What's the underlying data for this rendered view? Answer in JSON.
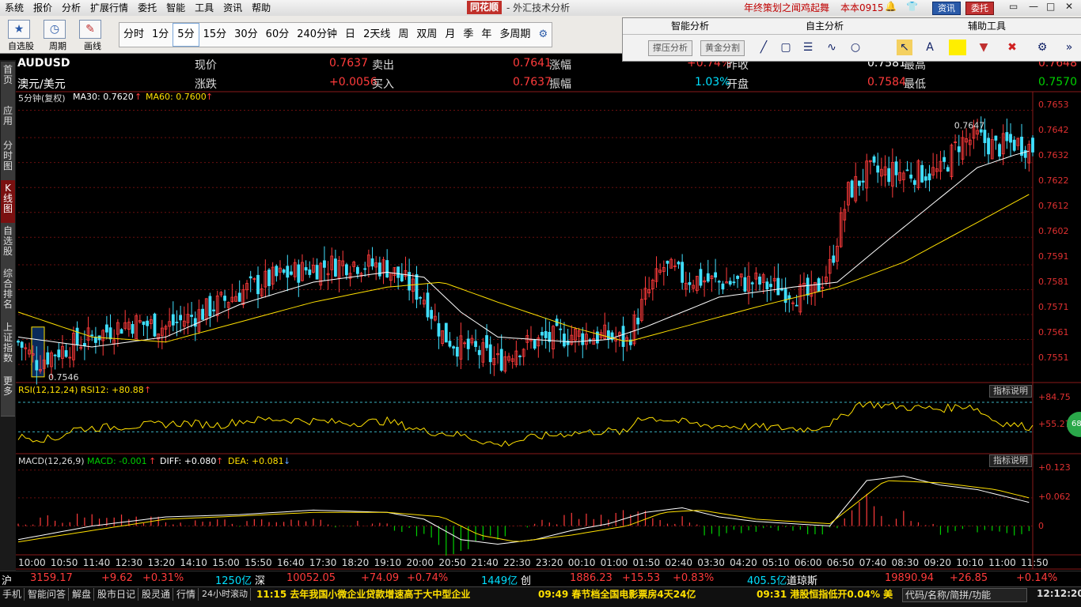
{
  "menu": [
    "系统",
    "报价",
    "分析",
    "扩展行情",
    "委托",
    "智能",
    "工具",
    "资讯",
    "帮助"
  ],
  "logo": "同花顺",
  "app_title": "- 外汇技术分析",
  "promo": "年终策划之闻鸡起舞",
  "version": "本本0915",
  "btn_news": "资讯",
  "btn_trade": "委托",
  "toolbar": {
    "select_label": "自选股",
    "period_label": "周期",
    "draw_label": "画线"
  },
  "periods": [
    "分时",
    "1分",
    "5分",
    "15分",
    "30分",
    "60分",
    "240分钟",
    "日",
    "2天线",
    "周",
    "双周",
    "月",
    "季",
    "年",
    "多周期"
  ],
  "periods_selected": "5分",
  "panel": {
    "smart": "智能分析",
    "custom": "自主分析",
    "aux": "辅助工具",
    "btn_support": "撑压分析",
    "btn_golden": "黄金分割"
  },
  "left_tabs": [
    "首页",
    "应用",
    "分时图",
    "K线图",
    "自选股",
    "综合排名",
    "上证指数",
    "更多"
  ],
  "left_tab_selected": "K线图",
  "quote": {
    "symbol": "AUDUSD",
    "name": "澳元/美元",
    "l_now": "现价",
    "v_now": "0.7637",
    "l_change": "涨跌",
    "v_change": "+0.0056",
    "l_sell": "卖出",
    "v_sell": "0.7641",
    "l_buy": "买入",
    "v_buy": "0.7637",
    "l_pct": "涨幅",
    "v_pct": "+0.74%",
    "l_amp": "振幅",
    "v_amp": "1.03%",
    "l_prev": "昨收",
    "v_prev": "0.7581",
    "l_open": "开盘",
    "v_open": "0.7584",
    "l_high": "最高",
    "v_high": "0.7648",
    "l_low": "最低",
    "v_low": "0.7570"
  },
  "main_info": {
    "period": "5分钟(复权)",
    "ma30": "MA30: 0.7620",
    "ma60": "MA60: 0.7600"
  },
  "rsi_info": "RSI(12,12,24)  RSI12: +80.88",
  "macd_info": {
    "name": "MACD(12,26,9)",
    "macd": "MACD: -0.001",
    "diff": "DIFF: +0.080",
    "dea": "DEA: +0.081"
  },
  "indicator_btn": "指标说明",
  "badge": "68",
  "chart_data": {
    "type": "candlestick",
    "series": [
      {
        "name": "MA30"
      },
      {
        "name": "MA60"
      }
    ],
    "y_ticks": [
      "0.7653",
      "0.7642",
      "0.7632",
      "0.7622",
      "0.7612",
      "0.7602",
      "0.7591",
      "0.7581",
      "0.7571",
      "0.7561",
      "0.7551"
    ],
    "ylim": [
      0.7545,
      0.7656
    ],
    "high_label": "0.7647",
    "low_label": "0.7546",
    "close_path": [
      [
        0,
        0.756
      ],
      [
        5,
        0.7552
      ],
      [
        10,
        0.7556
      ],
      [
        20,
        0.7562
      ],
      [
        30,
        0.7568
      ],
      [
        40,
        0.7566
      ],
      [
        50,
        0.7572
      ],
      [
        60,
        0.758
      ],
      [
        70,
        0.7586
      ],
      [
        80,
        0.759
      ],
      [
        90,
        0.7592
      ],
      [
        100,
        0.759
      ],
      [
        110,
        0.7578
      ],
      [
        115,
        0.7563
      ],
      [
        120,
        0.7558
      ],
      [
        125,
        0.7556
      ],
      [
        130,
        0.7552
      ],
      [
        135,
        0.7558
      ],
      [
        140,
        0.756
      ],
      [
        150,
        0.7563
      ],
      [
        160,
        0.7562
      ],
      [
        165,
        0.756
      ],
      [
        170,
        0.7578
      ],
      [
        175,
        0.759
      ],
      [
        180,
        0.7586
      ],
      [
        190,
        0.7584
      ],
      [
        200,
        0.7584
      ],
      [
        210,
        0.758
      ],
      [
        215,
        0.7578
      ],
      [
        220,
        0.759
      ],
      [
        225,
        0.762
      ],
      [
        230,
        0.7628
      ],
      [
        240,
        0.7628
      ],
      [
        250,
        0.7628
      ],
      [
        255,
        0.764
      ],
      [
        260,
        0.7642
      ],
      [
        265,
        0.7638
      ],
      [
        270,
        0.764
      ],
      [
        275,
        0.7638
      ]
    ],
    "ma30_path": [
      [
        0,
        0.7562
      ],
      [
        20,
        0.7558
      ],
      [
        40,
        0.7562
      ],
      [
        60,
        0.7575
      ],
      [
        80,
        0.7584
      ],
      [
        100,
        0.7588
      ],
      [
        110,
        0.7586
      ],
      [
        120,
        0.7572
      ],
      [
        130,
        0.7562
      ],
      [
        150,
        0.756
      ],
      [
        160,
        0.7561
      ],
      [
        170,
        0.7566
      ],
      [
        190,
        0.7578
      ],
      [
        210,
        0.7582
      ],
      [
        222,
        0.7584
      ],
      [
        235,
        0.76
      ],
      [
        250,
        0.7618
      ],
      [
        260,
        0.763
      ],
      [
        270,
        0.7635
      ],
      [
        275,
        0.7637
      ]
    ],
    "ma60_path": [
      [
        0,
        0.7572
      ],
      [
        20,
        0.7562
      ],
      [
        40,
        0.756
      ],
      [
        60,
        0.7568
      ],
      [
        80,
        0.7576
      ],
      [
        100,
        0.7582
      ],
      [
        115,
        0.7584
      ],
      [
        130,
        0.7576
      ],
      [
        150,
        0.7566
      ],
      [
        165,
        0.756
      ],
      [
        180,
        0.7566
      ],
      [
        200,
        0.7574
      ],
      [
        222,
        0.7582
      ],
      [
        240,
        0.7592
      ],
      [
        260,
        0.7608
      ],
      [
        275,
        0.762
      ]
    ],
    "rsi": {
      "ticks": [
        "+84.75",
        "+55.27"
      ],
      "ylim": [
        35,
        95
      ],
      "path": [
        [
          0,
          50
        ],
        [
          10,
          48
        ],
        [
          15,
          58
        ],
        [
          25,
          60
        ],
        [
          35,
          62
        ],
        [
          45,
          64
        ],
        [
          55,
          62
        ],
        [
          60,
          66
        ],
        [
          70,
          68
        ],
        [
          80,
          66
        ],
        [
          90,
          64
        ],
        [
          100,
          66
        ],
        [
          110,
          56
        ],
        [
          120,
          52
        ],
        [
          130,
          42
        ],
        [
          140,
          50
        ],
        [
          150,
          54
        ],
        [
          160,
          56
        ],
        [
          165,
          54
        ],
        [
          168,
          70
        ],
        [
          175,
          68
        ],
        [
          185,
          62
        ],
        [
          200,
          60
        ],
        [
          215,
          58
        ],
        [
          222,
          66
        ],
        [
          228,
          84
        ],
        [
          240,
          80
        ],
        [
          250,
          78
        ],
        [
          258,
          82
        ],
        [
          265,
          66
        ],
        [
          270,
          62
        ],
        [
          275,
          60
        ]
      ]
    },
    "macd": {
      "ticks": [
        "+0.123",
        "+0.062",
        "0"
      ],
      "ylim": [
        -0.06,
        0.14
      ],
      "diff_path": [
        [
          0,
          -0.03
        ],
        [
          20,
          0.0
        ],
        [
          40,
          0.02
        ],
        [
          60,
          0.025
        ],
        [
          80,
          0.035
        ],
        [
          100,
          0.03
        ],
        [
          110,
          0.015
        ],
        [
          120,
          -0.03
        ],
        [
          130,
          -0.04
        ],
        [
          140,
          -0.03
        ],
        [
          150,
          -0.01
        ],
        [
          160,
          0.005
        ],
        [
          170,
          0.03
        ],
        [
          180,
          0.04
        ],
        [
          190,
          0.02
        ],
        [
          200,
          0.01
        ],
        [
          220,
          0.0
        ],
        [
          230,
          0.1
        ],
        [
          240,
          0.11
        ],
        [
          250,
          0.09
        ],
        [
          260,
          0.08
        ],
        [
          275,
          0.05
        ]
      ],
      "dea_path": [
        [
          0,
          -0.035
        ],
        [
          20,
          -0.01
        ],
        [
          40,
          0.015
        ],
        [
          60,
          0.022
        ],
        [
          80,
          0.03
        ],
        [
          100,
          0.03
        ],
        [
          115,
          0.02
        ],
        [
          125,
          -0.02
        ],
        [
          135,
          -0.035
        ],
        [
          150,
          -0.02
        ],
        [
          165,
          0.0
        ],
        [
          175,
          0.03
        ],
        [
          185,
          0.035
        ],
        [
          200,
          0.015
        ],
        [
          220,
          0.005
        ],
        [
          235,
          0.1
        ],
        [
          250,
          0.095
        ],
        [
          265,
          0.08
        ],
        [
          275,
          0.06
        ]
      ]
    },
    "time_labels": [
      "10:00",
      "10:50",
      "11:40",
      "12:30",
      "13:20",
      "14:10",
      "15:00",
      "15:50",
      "16:40",
      "17:30",
      "18:20",
      "19:10",
      "20:00",
      "20:50",
      "21:40",
      "22:30",
      "23:20",
      "00:10",
      "01:00",
      "01:50",
      "02:40",
      "03:30",
      "04:20",
      "05:10",
      "06:00",
      "06:50",
      "07:40",
      "08:30",
      "09:20",
      "10:10",
      "11:00",
      "11:50"
    ]
  },
  "status": {
    "sh_label": "沪",
    "sh_val": "3159.17",
    "sh_chg": "+9.62",
    "sh_pct": "+0.31%",
    "sh_amt": "1250亿",
    "sz_label": "深",
    "sz_val": "10052.05",
    "sz_chg": "+74.09",
    "sz_pct": "+0.74%",
    "sz_amt": "1449亿",
    "cy_label": "创",
    "cy_val": "1886.23",
    "cy_chg": "+15.53",
    "cy_pct": "+0.83%",
    "cy_amt": "405.5亿",
    "dj_label": "道琼斯",
    "dj_val": "19890.94",
    "dj_chg": "+26.85",
    "dj_pct": "+0.14%"
  },
  "bottom": {
    "btns": [
      "手机",
      "智能问答",
      "解盘",
      "股市日记",
      "股灵通",
      "行情",
      "24小时滚动"
    ],
    "news1": "11:15 去年我国小微企业贷款增速高于大中型企业",
    "news2": "09:49 春节档全国电影票房4天24亿",
    "news3": "09:31 港股恒指低开0.04% 美",
    "search": "代码/名称/简拼/功能",
    "clock": "12:12:20"
  }
}
